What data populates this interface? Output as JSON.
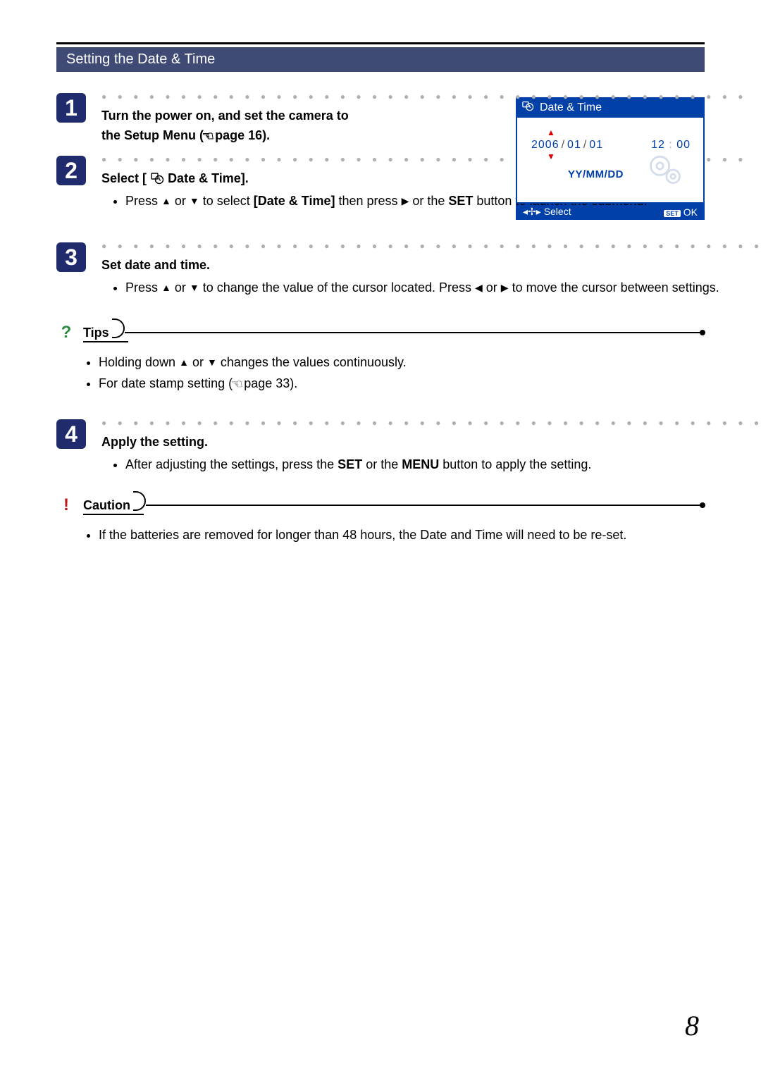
{
  "section_title": "Setting the Date & Time",
  "lcd": {
    "header": "Date & Time",
    "date_year": "2006",
    "date_month": "01",
    "date_day": "01",
    "time_hour": "12",
    "time_min": "00",
    "format": "YY/MM/DD",
    "footer_left": "Select",
    "footer_set": "SET",
    "footer_ok": "OK"
  },
  "steps": [
    {
      "num": "1",
      "head_a": "Turn the power on, and set the camera to",
      "head_b": "the Setup Menu (",
      "head_c": "page 16)."
    },
    {
      "num": "2",
      "head_a": "Select [",
      "head_b": " Date & Time].",
      "bullet1_a": "Press ",
      "bullet1_b": " or ",
      "bullet1_c": " to select ",
      "bullet1_bold": "[Date & Time]",
      "bullet1_d": " then press ",
      "bullet1_e": " or the ",
      "bullet1_set": "SET",
      "bullet1_f": " button to launch the submenu."
    },
    {
      "num": "3",
      "head": "Set date and time.",
      "bullet1_a": "Press ",
      "bullet1_b": " or ",
      "bullet1_c": " to change the value of the cursor located.   Press ",
      "bullet1_d": " or ",
      "bullet1_e": " to move the cursor between settings."
    },
    {
      "num": "4",
      "head": "Apply the setting.",
      "bullet1_a": "After adjusting the settings, press the ",
      "bullet1_set": "SET",
      "bullet1_b": " or the ",
      "bullet1_menu": "MENU",
      "bullet1_c": " button to apply the setting."
    }
  ],
  "tips": {
    "label": "Tips",
    "item1_a": "Holding down ",
    "item1_b": " or ",
    "item1_c": " changes the values continuously.",
    "item2_a": "For date stamp setting (",
    "item2_b": "page 33)."
  },
  "caution": {
    "label": "Caution",
    "item1": "If the batteries are removed for longer than 48 hours, the Date and Time will need to be re-set."
  },
  "page_number": "8"
}
